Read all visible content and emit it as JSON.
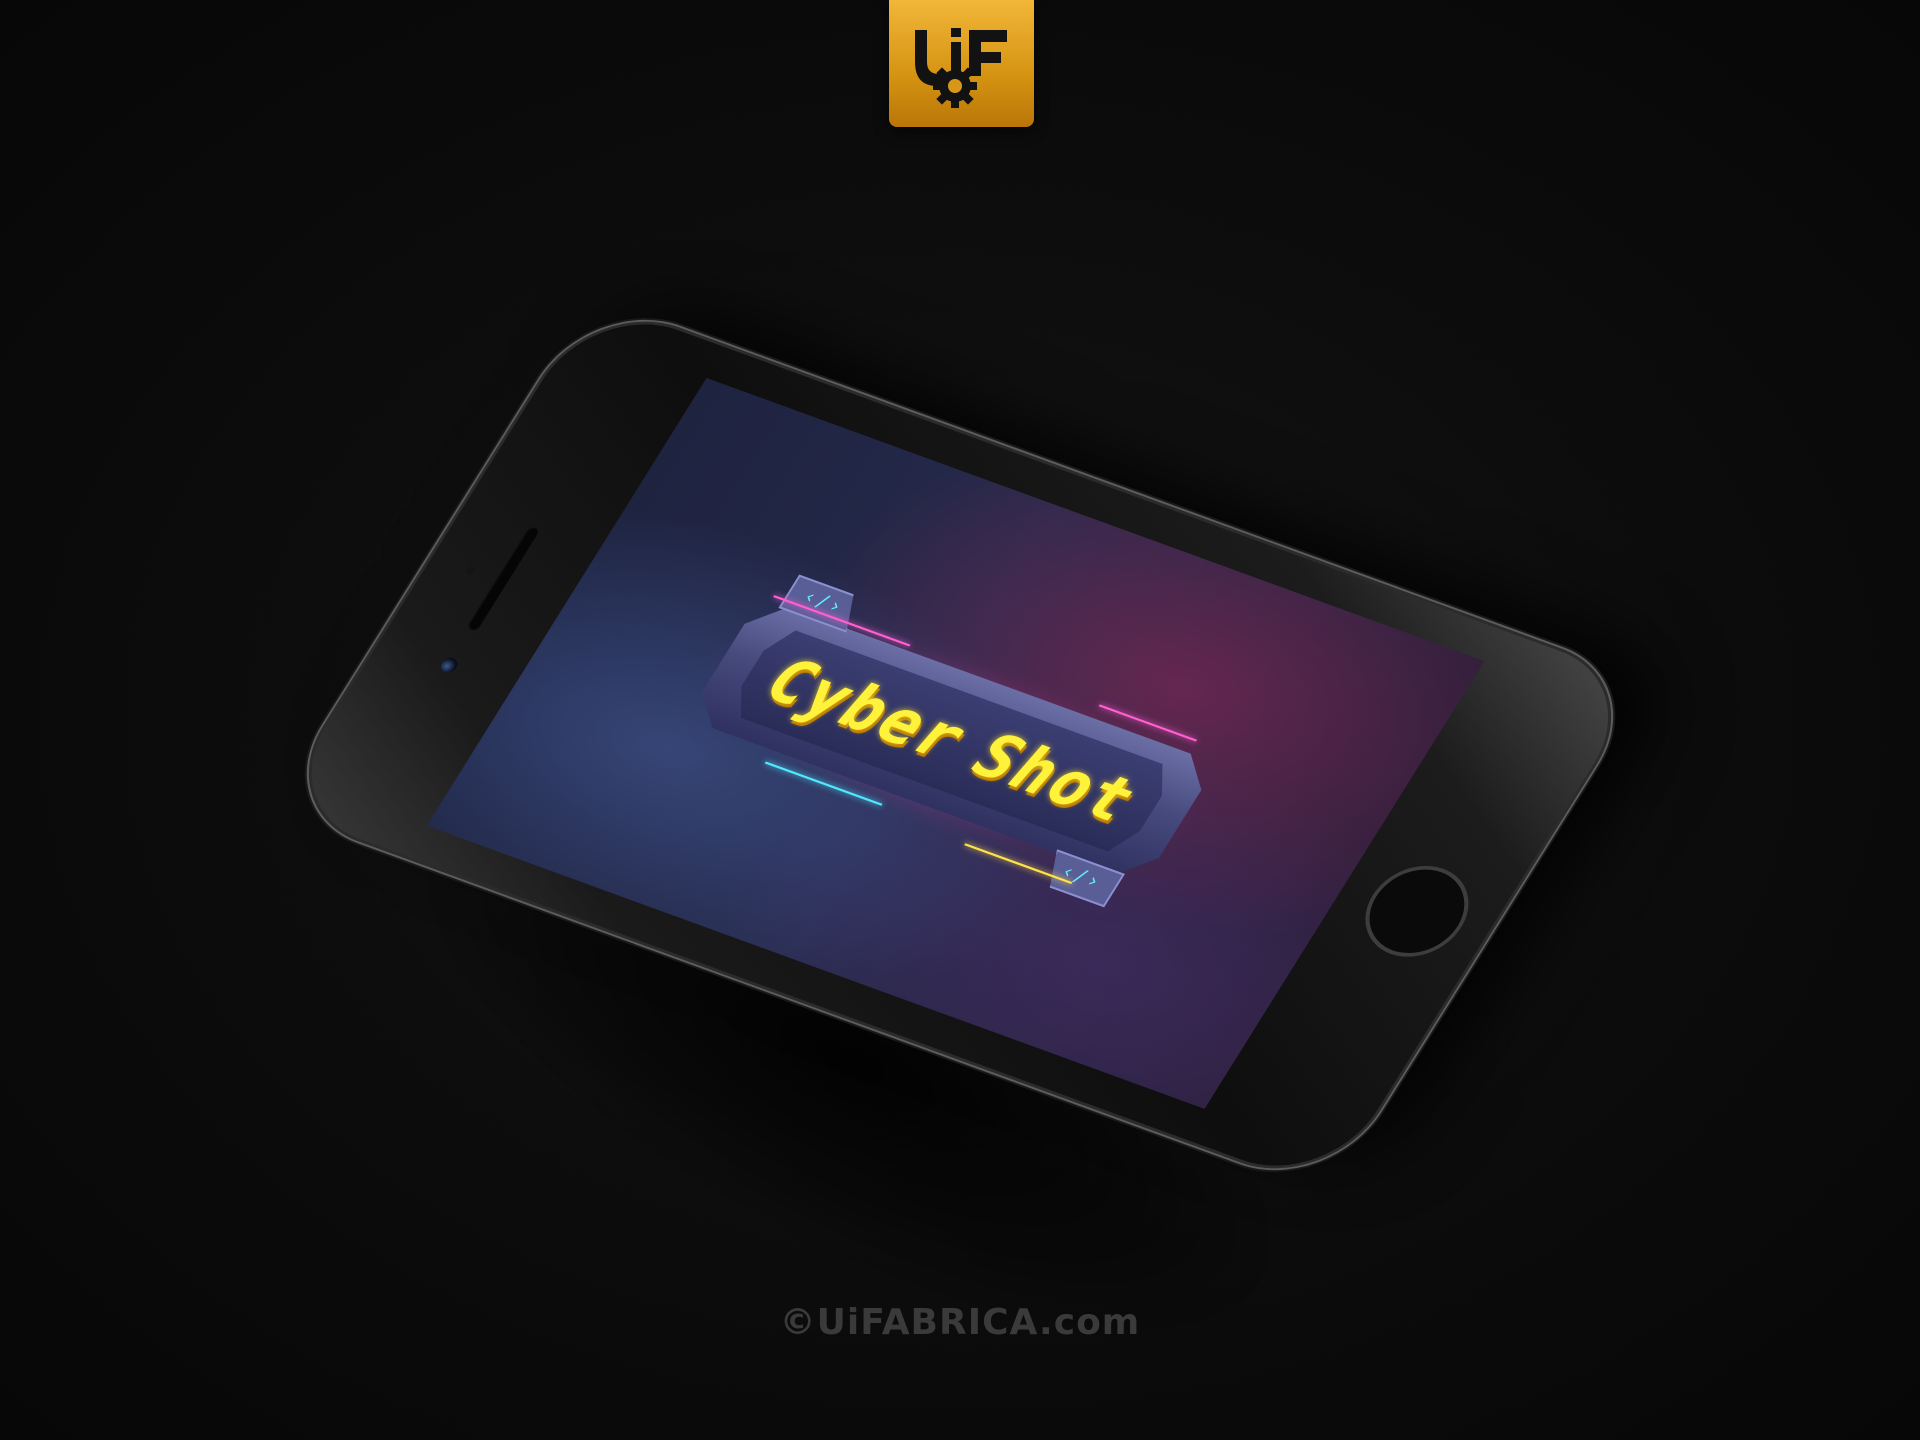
{
  "brand": {
    "logo_name": "uif-gear-logo",
    "logo_colors": {
      "badge": "#e0a020",
      "glyph": "#121212"
    }
  },
  "device": {
    "model": "smartphone",
    "body_color": "#151515"
  },
  "game": {
    "title_words": [
      "Cyber",
      "Shot"
    ],
    "bracket_glyph_left": "‹/›",
    "bracket_glyph_right": "‹/›",
    "accent_colors": {
      "title": "#fff23a",
      "glow": "#ff46aa",
      "circuit": "#4fe8ff",
      "frame": "#5a5e96"
    }
  },
  "footer": {
    "copyright": "©UiFABRICA.com"
  }
}
